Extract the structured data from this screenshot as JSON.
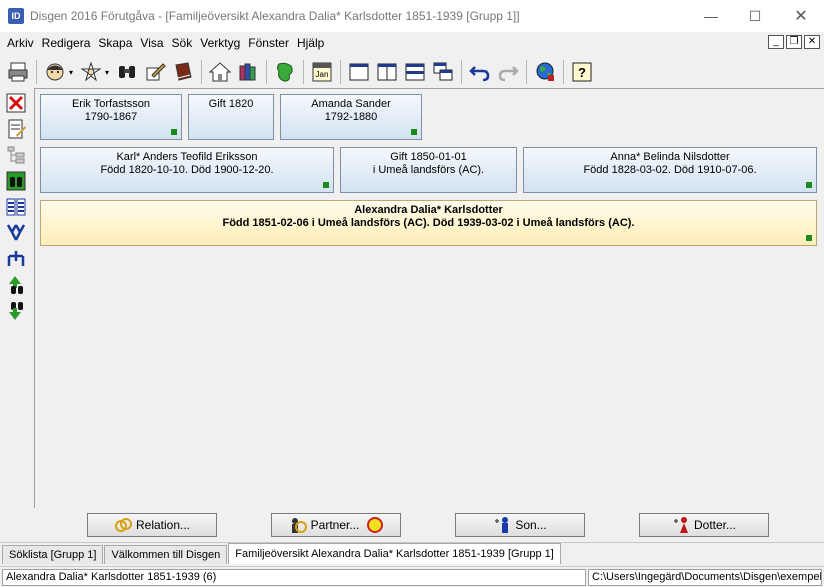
{
  "window": {
    "title": "Disgen 2016 Förutgåva - [Familjeöversikt Alexandra Dalia* Karlsdotter 1851-1939 [Grupp 1]]",
    "app_icon_text": "ID",
    "min_glyph": "—",
    "max_glyph": "☐",
    "close_glyph": "✕"
  },
  "menu": {
    "items": [
      "Arkiv",
      "Redigera",
      "Skapa",
      "Visa",
      "Sök",
      "Verktyg",
      "Fönster",
      "Hjälp"
    ],
    "mdi": [
      "_",
      "❐",
      "✕"
    ]
  },
  "toolbar": {
    "calendar_label": "Jan"
  },
  "grandparents": {
    "father": {
      "name": "Erik Torfastsson",
      "years": "1790-1867"
    },
    "marriage": {
      "text": "Gift 1820"
    },
    "mother": {
      "name": "Amanda Sander",
      "years": "1792-1880"
    }
  },
  "parents": {
    "father": {
      "name": "Karl* Anders Teofild Eriksson",
      "detail": "Född 1820-10-10. Död 1900-12-20."
    },
    "marriage": {
      "text": "Gift 1850-01-01",
      "place": "i  Umeå landsförs (AC)."
    },
    "mother": {
      "name": "Anna* Belinda Nilsdotter",
      "detail": "Född 1828-03-02. Död 1910-07-06."
    }
  },
  "person": {
    "name": "Alexandra Dalia* Karlsdotter",
    "detail": "Född 1851-02-06 i Umeå landsförs (AC). Död 1939-03-02 i Umeå landsförs (AC)."
  },
  "buttons": {
    "relation": "Relation...",
    "partner": "Partner...",
    "son": "Son...",
    "daughter": "Dotter..."
  },
  "tabs": [
    "Söklista [Grupp 1]",
    "Välkommen till Disgen",
    "Familjeöversikt Alexandra Dalia* Karlsdotter 1851-1939 [Grupp 1]"
  ],
  "status": {
    "left": "Alexandra Dalia* Karlsdotter 1851-1939 (6)",
    "right": "C:\\Users\\Ingegärd\\Documents\\Disgen\\exempel"
  }
}
